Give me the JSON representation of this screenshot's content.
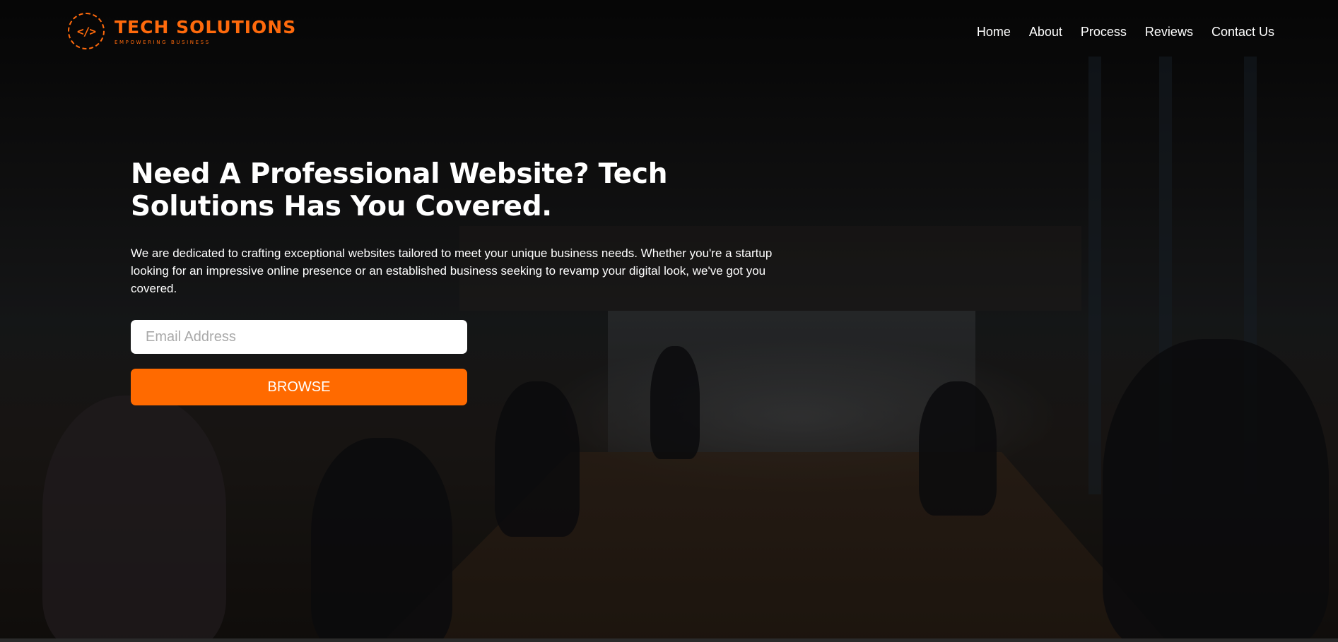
{
  "brand": {
    "name": "TECH SOLUTIONS",
    "tagline": "EMPOWERING BUSINESS",
    "icon": "code-icon",
    "accent_color": "#ff6a0c"
  },
  "nav": {
    "items": [
      {
        "label": "Home"
      },
      {
        "label": "About"
      },
      {
        "label": "Process"
      },
      {
        "label": "Reviews"
      },
      {
        "label": "Contact Us"
      }
    ]
  },
  "hero": {
    "heading": "Need A Professional Website? Tech Solutions Has You Covered.",
    "description": "We are dedicated to crafting exceptional websites tailored to meet your unique business needs. Whether you're a startup looking for an impressive online presence or an established business seeking to revamp your digital look, we've got you covered.",
    "email_placeholder": "Email Address",
    "email_value": "",
    "button_label": "BROWSE",
    "button_color": "#ff6a00"
  }
}
